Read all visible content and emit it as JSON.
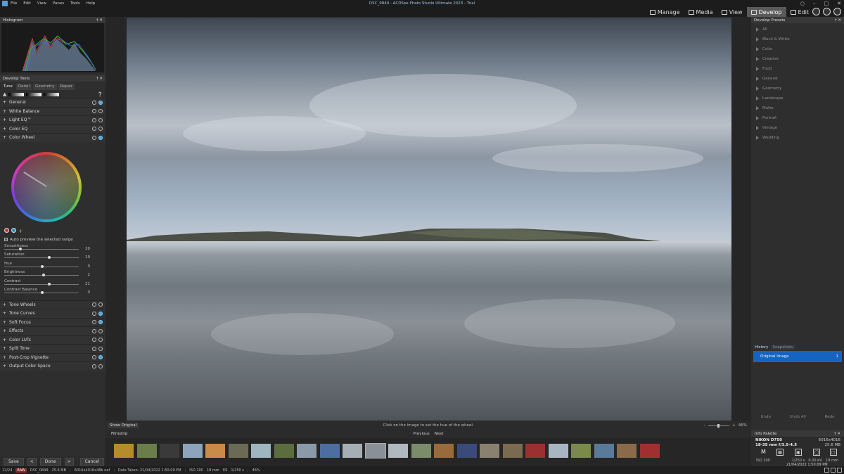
{
  "menu": [
    "File",
    "Edit",
    "View",
    "Panes",
    "Tools",
    "Help"
  ],
  "window_title": "DSC_0849 - ACDSee Photo Studio Ultimate 2023 - Trial",
  "modes": {
    "manage": "Manage",
    "media": "Media",
    "view": "View",
    "develop": "Develop",
    "edit": "Edit"
  },
  "histogram": {
    "title": "Histogram"
  },
  "develop_tools": {
    "title": "Develop Tools",
    "tabs": [
      "Tune",
      "Detail",
      "Geometry",
      "Repair"
    ],
    "groups_top": [
      "General",
      "White Balance",
      "Light EQ™",
      "Color EQ",
      "Color Wheel"
    ],
    "auto_preview": "Auto preview the selected range",
    "sliders": [
      {
        "label": "Smoothness",
        "value": "20",
        "fraction": 0.2
      },
      {
        "label": "Saturation",
        "value": "19",
        "fraction": 0.6
      },
      {
        "label": "Hue",
        "value": "0",
        "fraction": 0.5
      },
      {
        "label": "Brightness",
        "value": "2",
        "fraction": 0.52
      },
      {
        "label": "Contrast",
        "value": "21",
        "fraction": 0.6
      },
      {
        "label": "Contrast Balance",
        "value": "0",
        "fraction": 0.5
      }
    ],
    "groups_bottom": [
      "Tone Wheels",
      "Tone Curves",
      "Soft Focus",
      "Effects",
      "Color LUTs",
      "Split Tone",
      "Post-Crop Vignette",
      "Output Color Space"
    ]
  },
  "buttons": {
    "save": "Save",
    "prev": "<",
    "done": "Done",
    "next": ">",
    "cancel": "Cancel"
  },
  "center": {
    "show_original": "Show Original",
    "hint": "Click on the image to set the hue of the wheel.",
    "zoom": "46%",
    "zoom_fraction": 0.45
  },
  "filmstrip": {
    "title": "Filmstrip",
    "previous": "Previous",
    "next": "Next",
    "thumb_colors": [
      "#b58b2b",
      "#6b7d4a",
      "#3a3a3a",
      "#8ea4bd",
      "#c98a4a",
      "#6a6a55",
      "#9fb5c0",
      "#5b6d3d",
      "#8a9aa8",
      "#4c6ea0",
      "#a5aeb5",
      "#8a9097",
      "#b0b8c0",
      "#7a8c6a",
      "#9a6a3a",
      "#3a4a7a",
      "#8a8070",
      "#7a6a50",
      "#9a3030",
      "#a8b6c4",
      "#7a8a4a",
      "#5a7a9a",
      "#8a6a4a",
      "#a03030"
    ]
  },
  "presets": {
    "title": "Develop Presets",
    "items": [
      "All",
      "Black & White",
      "Color",
      "Creative",
      "Food",
      "General",
      "Geometry",
      "Landscape",
      "Matte",
      "Portrait",
      "Vintage",
      "Wedding"
    ]
  },
  "history": {
    "tab_history": "History",
    "tab_snapshots": "Snapshots",
    "item": "Original Image",
    "item_index": "1",
    "undo": "Undo",
    "undo_all": "Undo All",
    "redo": "Redo"
  },
  "info_palette": {
    "title": "Info Palette",
    "camera": "NIKON D750",
    "resolution": "6016x4016",
    "lens": "18-35 mm f/3.5-4.5",
    "size": "25.6 MB",
    "mode": "M",
    "iso": "ISO 100",
    "shutter": "1/250 s",
    "ev": "0.00 eV",
    "focal": "18 mm",
    "date": "21/04/2022 1:50:09 PM"
  },
  "statusbar": {
    "count": "12/24",
    "raw": "RAW",
    "file": "DSC_0849",
    "size": "25.6 MB",
    "dims": "6016x4016x48b nef",
    "date": "Date Taken: 21/04/2022 1:50:09 PM",
    "iso": "ISO 100",
    "focal": "18 mm",
    "fstop": "f/9",
    "shutter": "1/250 s",
    "zoom": "46%"
  }
}
